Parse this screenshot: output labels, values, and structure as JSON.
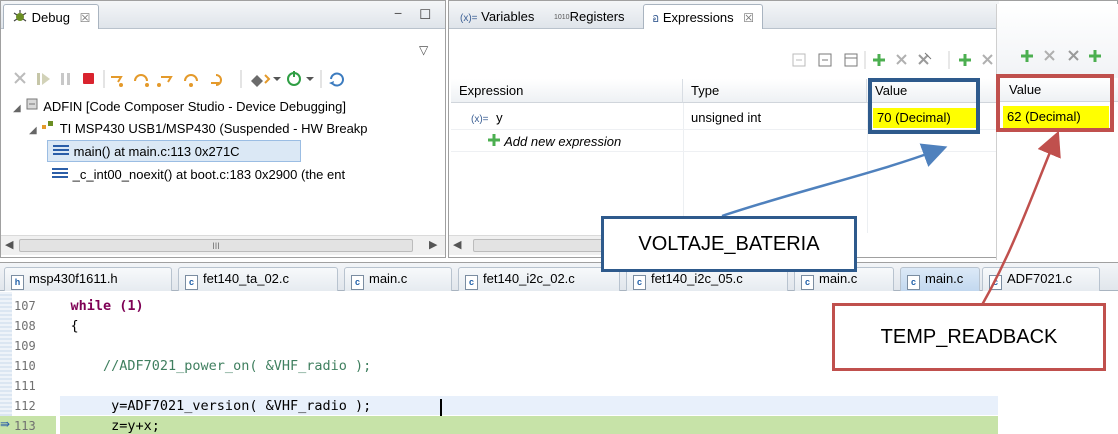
{
  "debug_view": {
    "tab_label": "Debug",
    "close_glyph": "☒",
    "minimize_glyph": "−",
    "maximize_glyph": "◻",
    "view_menu_glyph": "▽",
    "tree": [
      {
        "label": "ADFIN [Code Composer Studio - Device Debugging]",
        "icon": "project-icon"
      },
      {
        "label": "TI MSP430 USB1/MSP430 (Suspended - HW Breakp",
        "icon": "thread-icon"
      },
      {
        "label": "main() at main.c:113 0x271C",
        "icon": "stack-frame-icon"
      },
      {
        "label": "_c_int00_noexit() at boot.c:183 0x2900  (the ent",
        "icon": "stack-frame-icon"
      }
    ],
    "scroll_marker": "III"
  },
  "expressions_view": {
    "tabs": [
      {
        "prefix": "(x)=",
        "label": "Variables"
      },
      {
        "prefix": "1010",
        "label": "Registers"
      },
      {
        "prefix": "อ",
        "label": "Expressions"
      }
    ],
    "columns": {
      "expression": "Expression",
      "type": "Type",
      "value": "Value",
      "value2": "Value"
    },
    "rows": [
      {
        "var_prefix": "(x)=",
        "expression": "y",
        "type": "unsigned int",
        "value": "70 (Decimal)",
        "value2": "62 (Decimal)"
      }
    ],
    "add_expression": "Add new expression"
  },
  "editor": {
    "tabs": [
      {
        "label": "msp430f1611.h",
        "icon": "h"
      },
      {
        "label": "fet140_ta_02.c",
        "icon": "c"
      },
      {
        "label": "main.c",
        "icon": "c"
      },
      {
        "label": "fet140_i2c_02.c",
        "icon": "c"
      },
      {
        "label": "fet140_i2c_05.c",
        "icon": "c"
      },
      {
        "label": "main.c",
        "icon": "c"
      },
      {
        "label": "main.c",
        "icon": "c"
      },
      {
        "label": "ADF7021.c",
        "icon": "c"
      }
    ],
    "lines": [
      {
        "num": "107",
        "code": "    while (1)"
      },
      {
        "num": "108",
        "code": "    {"
      },
      {
        "num": "109",
        "code": ""
      },
      {
        "num": "110",
        "code": "        //ADF7021_power_on( &VHF_radio );"
      },
      {
        "num": "111",
        "code": ""
      },
      {
        "num": "112",
        "code": "         y=ADF7021_version( &VHF_radio );"
      },
      {
        "num": "113",
        "code": "         z=y+x;"
      }
    ]
  },
  "callouts": {
    "voltage": "VOLTAJE_BATERIA",
    "temp": "TEMP_READBACK"
  },
  "colors": {
    "highlight_yellow": "#ffff00",
    "blue_annotation": "#2e5a8c",
    "red_annotation": "#c0504d",
    "current_line": "#c7e3a8",
    "tab_active": "#c2d8ef"
  }
}
